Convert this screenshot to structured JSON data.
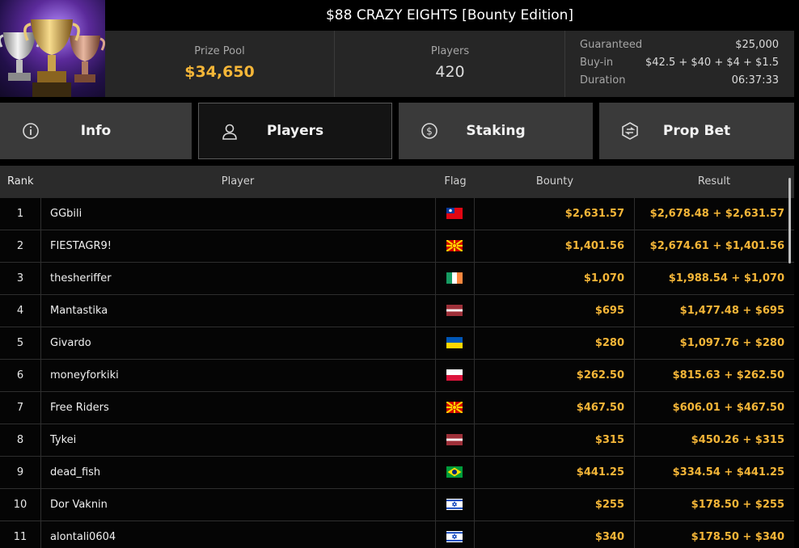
{
  "header": {
    "title": "$88 CRAZY EIGHTS [Bounty Edition]",
    "prize_pool_label": "Prize Pool",
    "prize_pool_value": "$34,650",
    "players_label": "Players",
    "players_value": "420",
    "details": [
      {
        "label": "Guaranteed",
        "value": "$25,000"
      },
      {
        "label": "Buy-in",
        "value": "$42.5 + $40 + $4 + $1.5"
      },
      {
        "label": "Duration",
        "value": "06:37:33"
      }
    ]
  },
  "tabs": [
    {
      "label": "Info",
      "icon": "info-icon",
      "active": false
    },
    {
      "label": "Players",
      "icon": "user-icon",
      "active": true
    },
    {
      "label": "Staking",
      "icon": "dollar-coin-icon",
      "active": false
    },
    {
      "label": "Prop Bet",
      "icon": "prop-bet-icon",
      "active": false
    }
  ],
  "table": {
    "columns": [
      "Rank",
      "Player",
      "Flag",
      "Bounty",
      "Result"
    ],
    "rows": [
      {
        "rank": "1",
        "player": "GGbili",
        "flag": "taiwan",
        "bounty": "$2,631.57",
        "result": "$2,678.48 + $2,631.57"
      },
      {
        "rank": "2",
        "player": "FIESTAGR9!",
        "flag": "north-macedonia",
        "bounty": "$1,401.56",
        "result": "$2,674.61 + $1,401.56"
      },
      {
        "rank": "3",
        "player": "thesheriffer",
        "flag": "ireland",
        "bounty": "$1,070",
        "result": "$1,988.54 + $1,070"
      },
      {
        "rank": "4",
        "player": "Mantastika",
        "flag": "latvia",
        "bounty": "$695",
        "result": "$1,477.48 + $695"
      },
      {
        "rank": "5",
        "player": "Givardo",
        "flag": "ukraine",
        "bounty": "$280",
        "result": "$1,097.76 + $280"
      },
      {
        "rank": "6",
        "player": "moneyforkiki",
        "flag": "poland",
        "bounty": "$262.50",
        "result": "$815.63 + $262.50"
      },
      {
        "rank": "7",
        "player": "Free Riders",
        "flag": "north-macedonia",
        "bounty": "$467.50",
        "result": "$606.01 + $467.50"
      },
      {
        "rank": "8",
        "player": "Tykei",
        "flag": "latvia",
        "bounty": "$315",
        "result": "$450.26 + $315"
      },
      {
        "rank": "9",
        "player": "dead_fish",
        "flag": "brazil",
        "bounty": "$441.25",
        "result": "$334.54 + $441.25"
      },
      {
        "rank": "10",
        "player": "Dor Vaknin",
        "flag": "israel",
        "bounty": "$255",
        "result": "$178.50 + $255"
      },
      {
        "rank": "11",
        "player": "alontali0604",
        "flag": "israel",
        "bounty": "$340",
        "result": "$178.50 + $340"
      }
    ]
  },
  "colors": {
    "accent_gold": "#f5b638",
    "panel": "#262626",
    "tab_bg": "#3a3a3a",
    "tab_active_bg": "#141414"
  }
}
